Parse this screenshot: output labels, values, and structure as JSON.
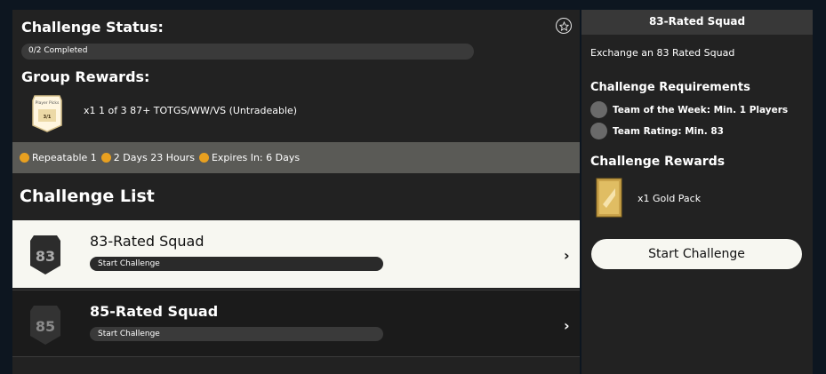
{
  "left": {
    "status_title": "Challenge Status:",
    "progress_text": "0/2 Completed",
    "progress_fraction": 0,
    "rewards_title": "Group Rewards:",
    "reward_text": "x1 1 of 3 87+ TOTGS/WW/VS (Untradeable)",
    "reward_card_top": "Player Picks",
    "reward_card_mid": "3/1",
    "info": {
      "repeatable": "Repeatable 1",
      "refresh": "2 Days 23 Hours",
      "expires": "Expires In: 6 Days"
    },
    "list_title": "Challenge List",
    "challenges": [
      {
        "rating": "83",
        "title": "83-Rated Squad",
        "button": "Start Challenge",
        "chevron": "›"
      },
      {
        "rating": "85",
        "title": "85-Rated Squad",
        "button": "Start Challenge",
        "chevron": "›"
      }
    ]
  },
  "right": {
    "header": "83-Rated Squad",
    "description": "Exchange an 83 Rated Squad",
    "requirements_title": "Challenge Requirements",
    "requirements": [
      "Team of the Week: Min. 1 Players",
      "Team Rating: Min. 83"
    ],
    "rewards_title": "Challenge Rewards",
    "reward": "x1 Gold Pack",
    "start_button": "Start Challenge"
  },
  "colors": {
    "accent_gold": "#e8a020",
    "panel": "#222222",
    "highlight_row": "#f7f7f1"
  },
  "icons": [
    "star-icon",
    "repeat-icon",
    "refresh-icon",
    "clock-icon",
    "chevron-right-icon"
  ]
}
